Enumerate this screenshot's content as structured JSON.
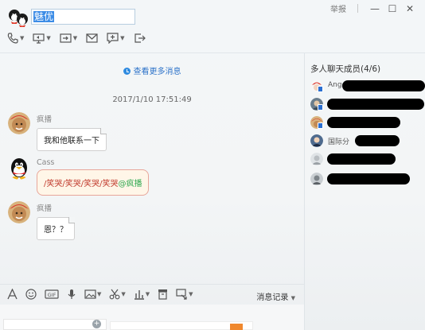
{
  "window": {
    "title": "魅优",
    "report_label": "举报",
    "minimize_glyph": "—",
    "maximize_glyph": "☐",
    "close_glyph": "✕"
  },
  "toolbar_top": {
    "icons": [
      "phone-icon",
      "screen-share-icon",
      "remote-assist-icon",
      "mail-icon",
      "app-add-icon",
      "share-exit-icon"
    ]
  },
  "chat": {
    "more_messages": "查看更多消息",
    "timestamp": "2017/1/10 17:51:49",
    "messages": [
      {
        "sender": "疯播",
        "text": "我和他联系一下"
      },
      {
        "sender": "Cass",
        "text": "/笑哭/笑哭/笑哭/笑哭",
        "mention": "@疯播"
      },
      {
        "sender": "疯播",
        "text": "恩？？"
      }
    ]
  },
  "members": {
    "title": "多人聊天成员(4/6)",
    "items": [
      {
        "name": "Angel"
      },
      {
        "name": "(hidden)"
      },
      {
        "name": "(hidden)"
      },
      {
        "name": "国际分"
      },
      {
        "name": ""
      },
      {
        "name": ""
      }
    ]
  },
  "input_toolbar": {
    "history_label": "消息记录"
  },
  "colors": {
    "accent": "#2f74c9",
    "selection": "#3c8ce6",
    "mention": "#2ea84f",
    "emoji_text": "#c0392b"
  }
}
